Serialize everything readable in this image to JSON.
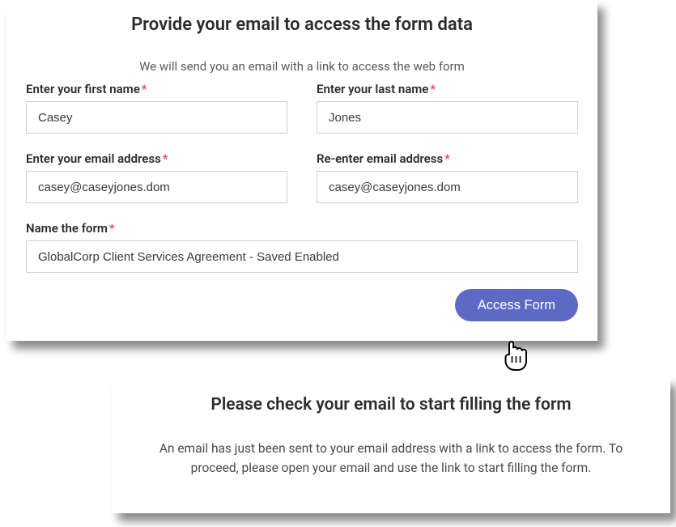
{
  "panel1": {
    "title": "Provide your email to access the form data",
    "subtitle": "We will send you an email with a link to access the web form",
    "fields": {
      "first_name": {
        "label": "Enter your first name",
        "value": "Casey"
      },
      "last_name": {
        "label": "Enter your last name",
        "value": "Jones"
      },
      "email": {
        "label": "Enter your email address",
        "value": "casey@caseyjones.dom"
      },
      "email_confirm": {
        "label": "Re-enter email address",
        "value": "casey@caseyjones.dom"
      },
      "form_name": {
        "label": "Name the form",
        "value": "GlobalCorp Client Services Agreement - Saved Enabled"
      }
    },
    "required_marker": "*",
    "button_label": "Access Form"
  },
  "panel2": {
    "title": "Please check your email to start filling the form",
    "body": "An email has just been sent to your email address with a link to access the form. To proceed, please open your email and use the link to start filling the form."
  }
}
